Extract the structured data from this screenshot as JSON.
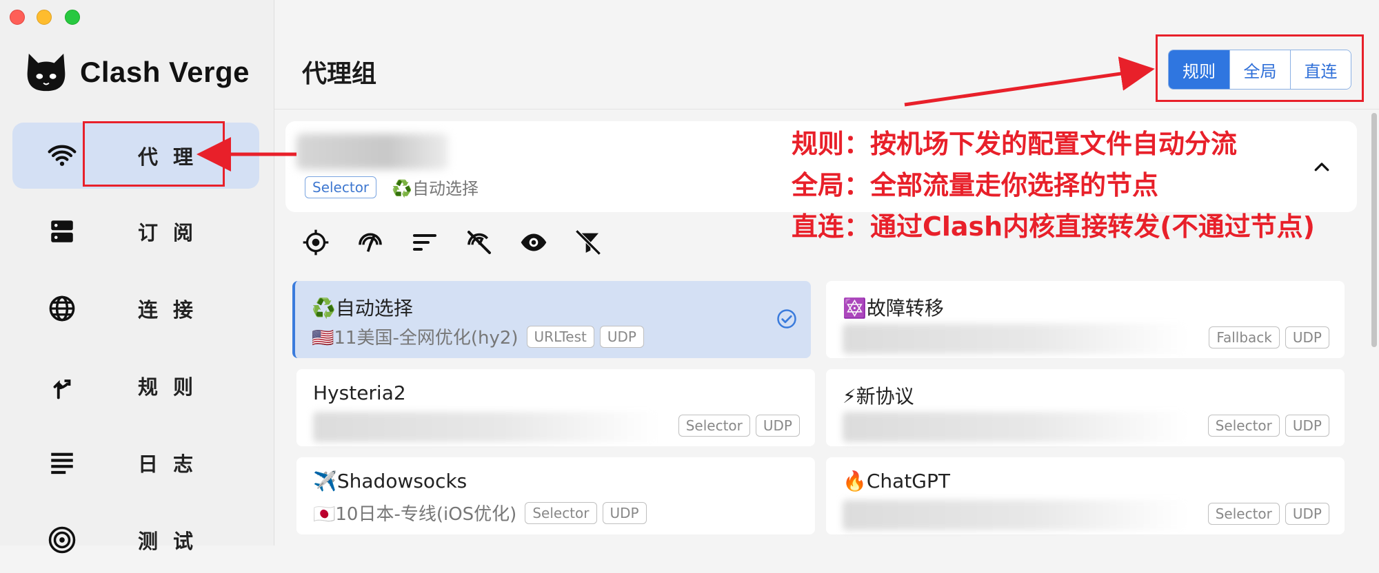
{
  "app": {
    "name": "Clash Verge"
  },
  "sidebar": {
    "items": [
      {
        "label": "代 理",
        "icon": "wifi-icon",
        "active": true
      },
      {
        "label": "订 阅",
        "icon": "server-icon",
        "active": false
      },
      {
        "label": "连 接",
        "icon": "globe-icon",
        "active": false
      },
      {
        "label": "规 则",
        "icon": "fork-arrow-icon",
        "active": false
      },
      {
        "label": "日 志",
        "icon": "lines-icon",
        "active": false
      },
      {
        "label": "测 试",
        "icon": "target-icon",
        "active": false
      }
    ]
  },
  "header": {
    "title": "代理组",
    "modes": [
      {
        "label": "规则",
        "selected": true
      },
      {
        "label": "全局",
        "selected": false
      },
      {
        "label": "直连",
        "selected": false
      }
    ]
  },
  "group": {
    "type": "Selector",
    "current": "♻️自动选择",
    "expanded": true
  },
  "toolbar": {
    "icons": [
      "locate-icon",
      "speed-test-icon",
      "sort-icon",
      "hide-unavailable-icon",
      "eye-icon",
      "filter-off-icon"
    ]
  },
  "proxies": [
    {
      "name": "♻️自动选择",
      "now": "🇺🇸11美国-全网优化(hy2)",
      "type": "URLTest",
      "udp": "UDP",
      "selected": true
    },
    {
      "name": "🔯故障转移",
      "now": "",
      "type": "Fallback",
      "udp": "UDP",
      "selected": false
    },
    {
      "name": "Hysteria2",
      "now": "",
      "type": "Selector",
      "udp": "UDP",
      "selected": false
    },
    {
      "name": "⚡新协议",
      "now": "",
      "type": "Selector",
      "udp": "UDP",
      "selected": false
    },
    {
      "name": "✈️Shadowsocks",
      "now": "🇯🇵10日本-专线(iOS优化)",
      "type": "Selector",
      "udp": "UDP",
      "selected": false
    },
    {
      "name": "🔥ChatGPT",
      "now": "",
      "type": "Selector",
      "udp": "UDP",
      "selected": false
    }
  ],
  "annotations": {
    "color": "#e8202a",
    "lines": [
      "规则：按机场下发的配置文件自动分流",
      "全局：全部流量走你选择的节点",
      "直连：通过Clash内核直接转发(不通过节点)"
    ]
  },
  "colors": {
    "accent": "#2f76e0",
    "active_bg": "#d4e0f4"
  }
}
